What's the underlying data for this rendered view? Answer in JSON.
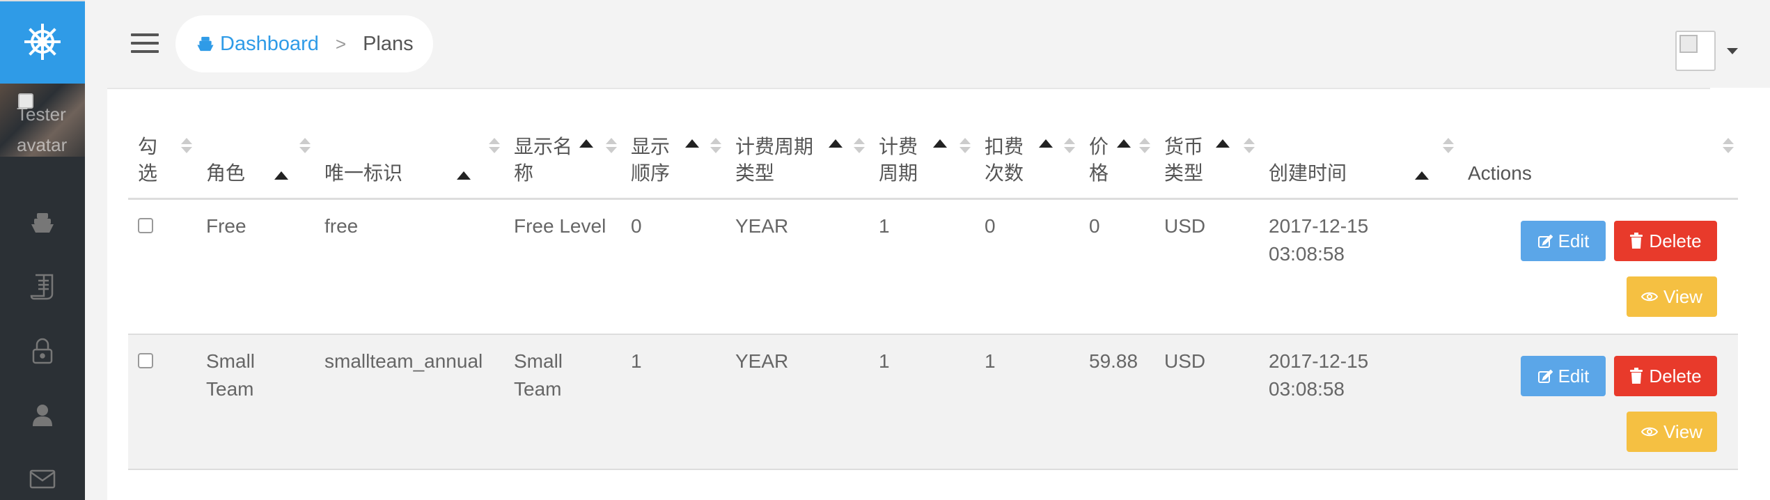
{
  "sidebar": {
    "brand_icon": "ship-wheel-icon",
    "avatar_alt": "Tester avatar",
    "nav": [
      "ship-icon",
      "receipt-icon",
      "lock-icon",
      "user-icon",
      "mail-icon"
    ]
  },
  "header": {
    "breadcrumb": {
      "home": "Dashboard",
      "separator": ">",
      "current": "Plans"
    }
  },
  "table": {
    "columns": [
      {
        "label": "勾\n选"
      },
      {
        "label": "角色"
      },
      {
        "label": "唯一标识"
      },
      {
        "label": "显示名\n称"
      },
      {
        "label": "显示\n顺序"
      },
      {
        "label": "计费周期\n类型"
      },
      {
        "label": "计费\n周期"
      },
      {
        "label": "扣费\n次数"
      },
      {
        "label": "价\n格"
      },
      {
        "label": "货币\n类型"
      },
      {
        "label": "创建时间"
      },
      {
        "label": "Actions"
      }
    ],
    "rows": [
      {
        "role": "Free",
        "key": "free",
        "display_name": "Free Level",
        "order": "0",
        "cycle_type": "YEAR",
        "cycle": "1",
        "charges": "0",
        "price": "0",
        "currency": "USD",
        "created": "2017-12-15\n03:08:58"
      },
      {
        "role": "Small\nTeam",
        "key": "smallteam_annual",
        "display_name": "Small\nTeam",
        "order": "1",
        "cycle_type": "YEAR",
        "cycle": "1",
        "charges": "1",
        "price": "59.88",
        "currency": "USD",
        "created": "2017-12-15\n03:08:58"
      }
    ],
    "actions": {
      "edit": "Edit",
      "delete": "Delete",
      "view": "View"
    }
  },
  "colors": {
    "brand": "#2f9be7",
    "edit": "#5ba6e8",
    "delete": "#e83a2b",
    "view": "#f5c042",
    "sidebar": "#2b3035"
  }
}
